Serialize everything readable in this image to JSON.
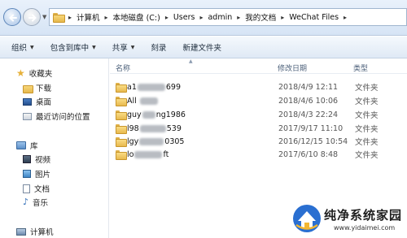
{
  "address": {
    "path": [
      "计算机",
      "本地磁盘 (C:)",
      "Users",
      "admin",
      "我的文档",
      "WeChat Files"
    ]
  },
  "toolbar": {
    "organize": "组织",
    "include_in_library": "包含到库中",
    "share": "共享",
    "burn": "刻录",
    "new_folder": "新建文件夹"
  },
  "nav": {
    "favorites": "收藏夹",
    "downloads": "下载",
    "desktop": "桌面",
    "recent": "最近访问的位置",
    "libraries": "库",
    "videos": "视频",
    "pictures": "图片",
    "documents": "文档",
    "music": "音乐",
    "computer": "计算机"
  },
  "columns": {
    "name": "名称",
    "modified": "修改日期",
    "type": "类型"
  },
  "files": [
    {
      "name_prefix": "a1",
      "name_suffix": "699",
      "date": "2018/4/9 12:11",
      "type": "文件夹"
    },
    {
      "name_prefix": "All ",
      "name_suffix": "",
      "date": "2018/4/6 10:06",
      "type": "文件夹"
    },
    {
      "name_prefix": "guy",
      "name_suffix": "ng1986",
      "date": "2018/4/3 22:24",
      "type": "文件夹"
    },
    {
      "name_prefix": "l98",
      "name_suffix": "539",
      "date": "2017/9/17 11:10",
      "type": "文件夹"
    },
    {
      "name_prefix": "lgy",
      "name_suffix": "0305",
      "date": "2016/12/15 10:54",
      "type": "文件夹"
    },
    {
      "name_prefix": "lo",
      "name_suffix": "ft",
      "date": "2017/6/10 8:48",
      "type": "文件夹"
    }
  ],
  "watermark": {
    "title": "纯净系统家园",
    "url": "www.yidaimei.com"
  },
  "colors": {
    "folder": "#e8ba4f",
    "accent": "#2f6db7",
    "watermark_logo": "#2a6fd1"
  }
}
